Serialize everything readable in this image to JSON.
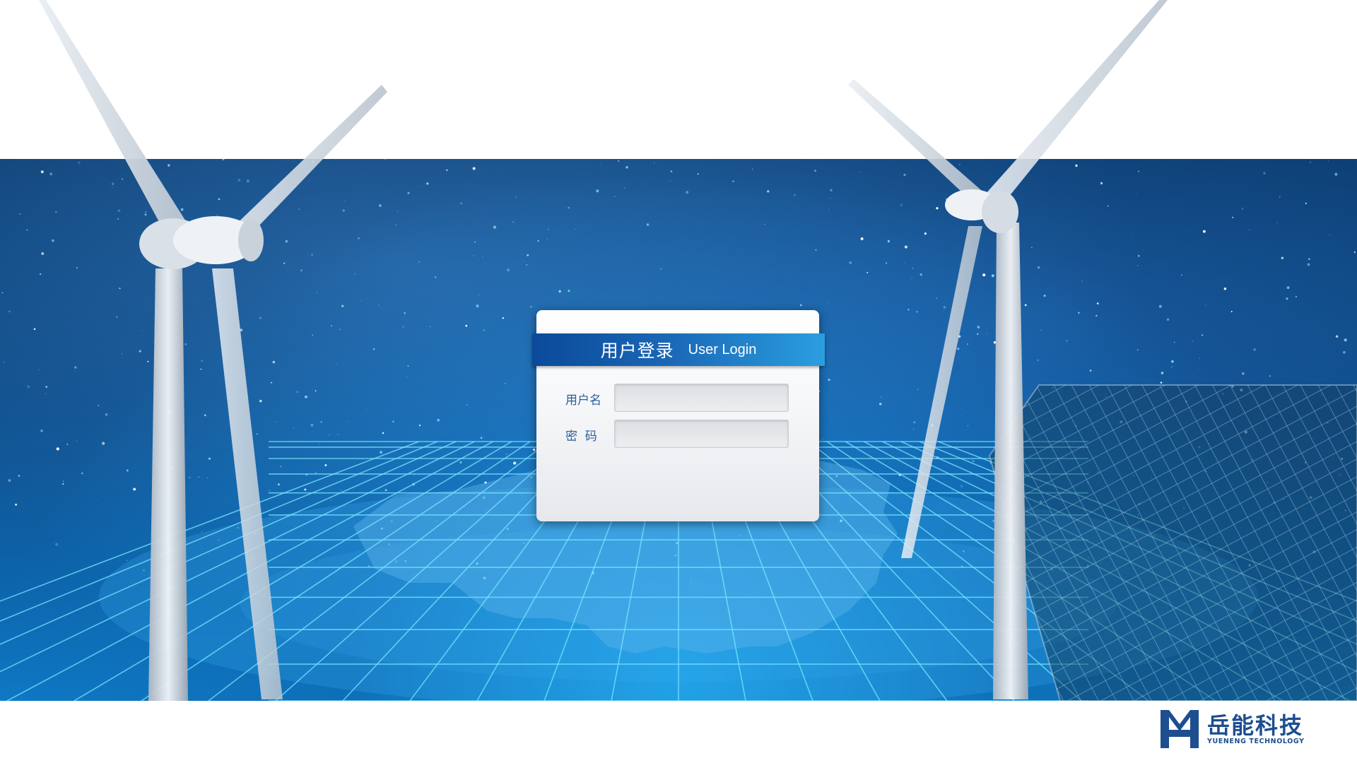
{
  "login": {
    "title_cn": "用户登录",
    "title_en": "User Login",
    "username_label": "用户名",
    "password_label": "密  码",
    "username_value": "",
    "password_value": ""
  },
  "logo": {
    "name_cn": "岳能科技",
    "name_en": "YUENENG TECHNOLOGY",
    "color": "#1d4e8f"
  },
  "colors": {
    "header_start": "#0b4a9a",
    "header_end": "#2a9ee0",
    "label": "#2b5f9a"
  }
}
